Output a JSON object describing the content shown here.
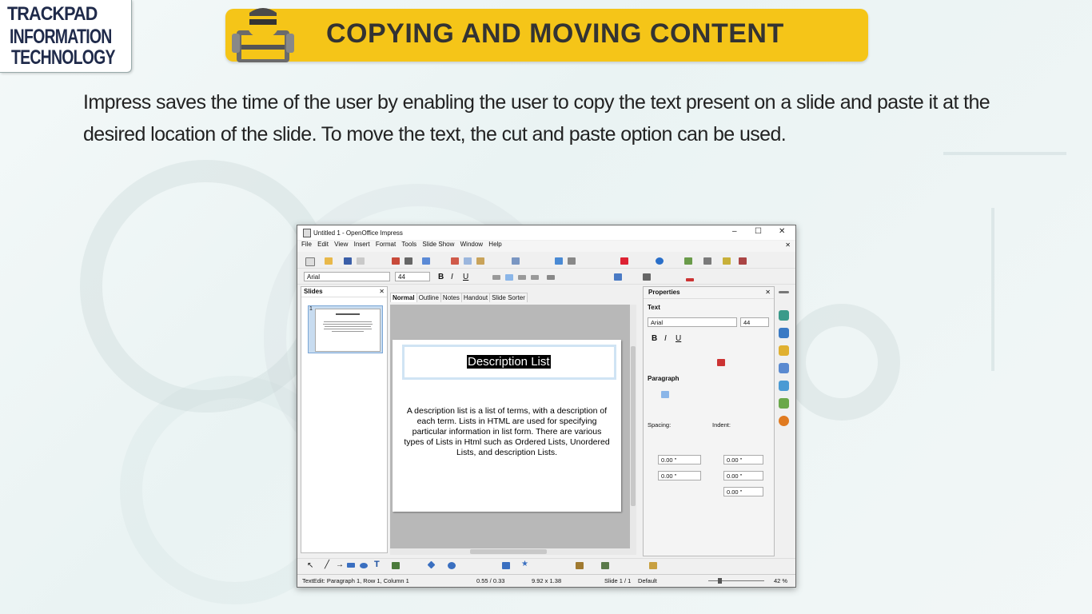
{
  "logo": {
    "line1": "TRACKPAD",
    "line2": "INFORMATION",
    "line3": "TECHNOLOGY"
  },
  "banner": {
    "title": "COPYING AND MOVING CONTENT"
  },
  "intro": "Impress saves the time of the user by enabling the user to copy the text present on a slide and paste it at the desired location of the slide. To move the text, the cut and paste option can be used.",
  "window": {
    "title": "Untitled 1 - OpenOffice Impress",
    "controls": {
      "minimize": "–",
      "maximize": "☐",
      "close": "✕"
    },
    "menu": [
      "File",
      "Edit",
      "View",
      "Insert",
      "Format",
      "Tools",
      "Slide Show",
      "Window",
      "Help"
    ],
    "format_bar": {
      "font": "Arial",
      "size": "44"
    },
    "slides_panel": {
      "title": "Slides",
      "slide_number": "1"
    },
    "view_tabs": [
      "Normal",
      "Outline",
      "Notes",
      "Handout",
      "Slide Sorter"
    ],
    "slide": {
      "title": "Description List",
      "body": "A description list is a list of terms, with a description of each term. Lists in HTML are used for specifying particular information in list form. There are various types of Lists in Html such as Ordered Lists, Unordered Lists, and description Lists."
    },
    "properties": {
      "title": "Properties",
      "text_section": "Text",
      "font": "Arial",
      "size": "44",
      "paragraph_section": "Paragraph",
      "spacing_label": "Spacing:",
      "indent_label": "Indent:",
      "spacing_values": [
        "0.00 \"",
        "0.00 \""
      ],
      "indent_values": [
        "0.00 \"",
        "0.00 \"",
        "0.00 \""
      ]
    },
    "status": {
      "mode": "TextEdit: Paragraph 1, Row 1, Column 1",
      "position": "0.55 / 0.33",
      "size": "9.92 x 1.38",
      "slide": "Slide 1 / 1",
      "layout": "Default",
      "zoom": "42 %"
    }
  },
  "colors": {
    "banner": "#f5c518",
    "logo_text": "#1f2a4a",
    "accent_icon": "#2a6fc9"
  }
}
